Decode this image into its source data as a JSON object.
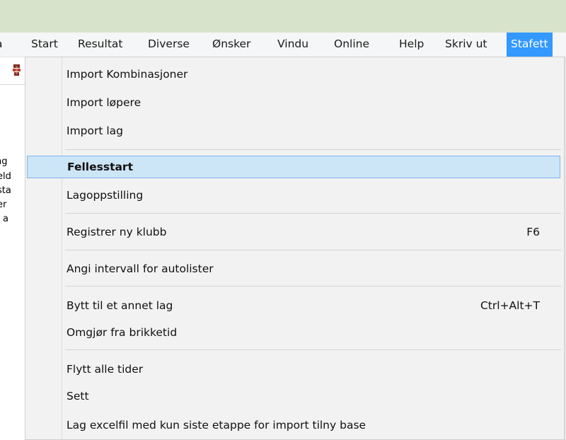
{
  "menubar": {
    "items": [
      {
        "label": "a"
      },
      {
        "label": "Start"
      },
      {
        "label": "Resultat"
      },
      {
        "label": "Diverse"
      },
      {
        "label": "Ønsker"
      },
      {
        "label": "Vindu"
      },
      {
        "label": "Online"
      },
      {
        "label": "Help"
      },
      {
        "label": "Skriv ut"
      },
      {
        "label": "Stafett"
      }
    ]
  },
  "left_panel": {
    "fragments": [
      "ng",
      "eld",
      "sta",
      "er",
      "a"
    ]
  },
  "dropdown": {
    "items": [
      {
        "label": "Import Kombinasjoner"
      },
      {
        "label": "Import løpere"
      },
      {
        "label": "Import lag"
      },
      {
        "label": "Fellesstart"
      },
      {
        "label": "Lagoppstilling"
      },
      {
        "label": "Registrer ny klubb",
        "shortcut": "F6"
      },
      {
        "label": "Angi intervall for autolister"
      },
      {
        "label": "Bytt til et annet lag",
        "shortcut": "Ctrl+Alt+T"
      },
      {
        "label": "Omgjør fra brikketid"
      },
      {
        "label": "Flytt alle tider"
      },
      {
        "label": "Sett"
      },
      {
        "label": "Lag excelfil med kun siste etappe for import tilny base"
      }
    ]
  },
  "colors": {
    "active_menu_bg": "#3399ff",
    "highlight_bg": "#cce5f7",
    "highlight_border": "#7eb4ea",
    "titlebar_bg": "#d8e3cc"
  },
  "icons": {
    "left_tool": "toolbar-tool-icon"
  }
}
